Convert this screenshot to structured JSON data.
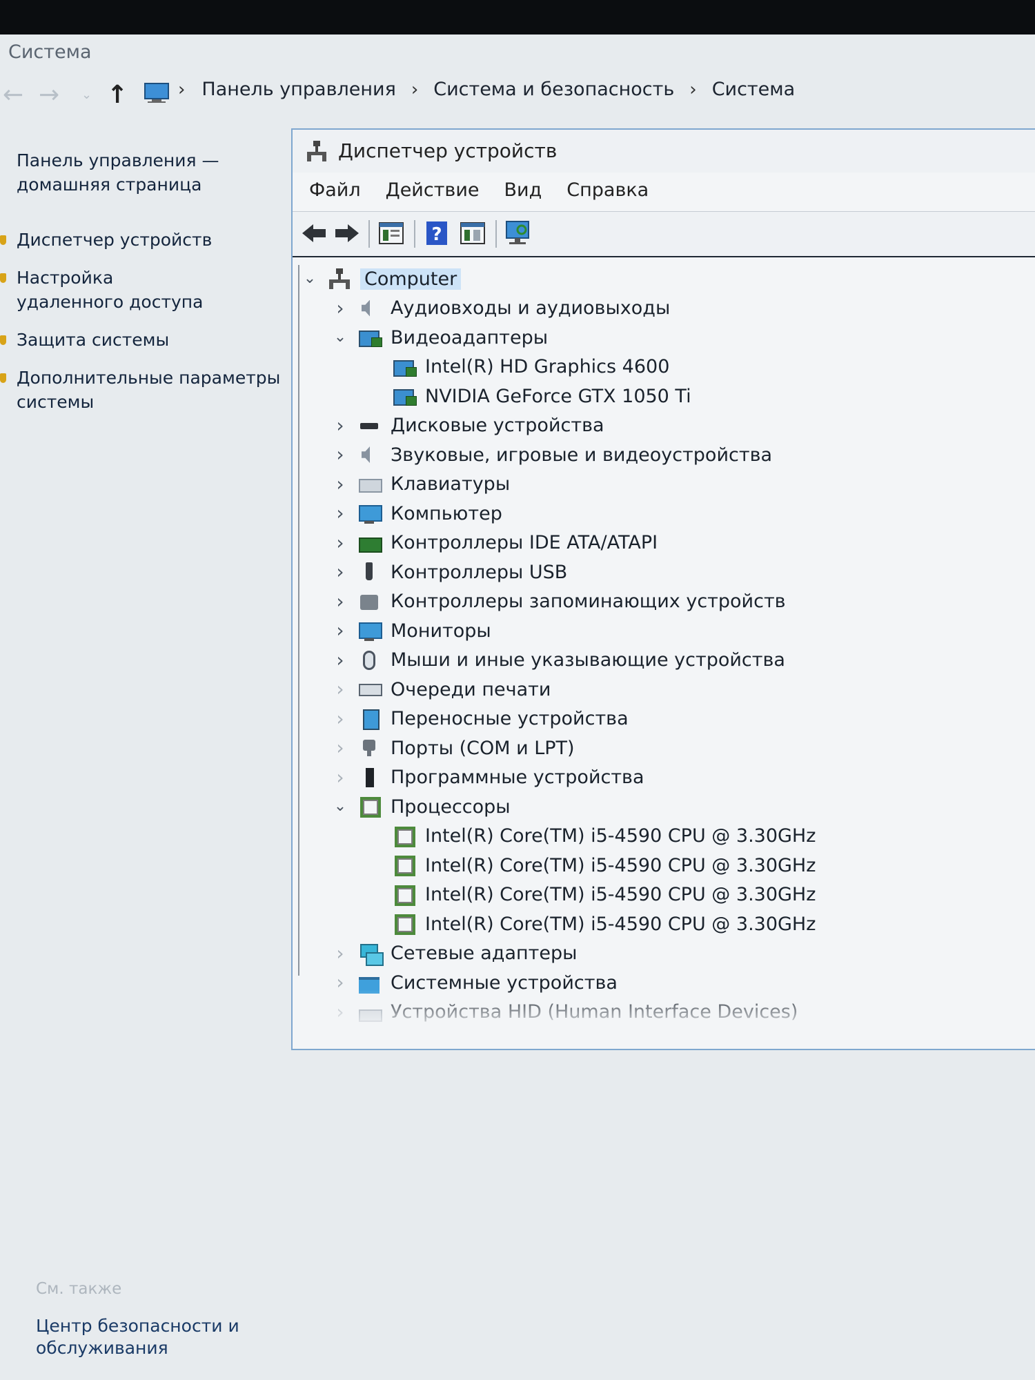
{
  "window": {
    "title": "Система"
  },
  "address": {
    "back_icon": "arrow-left-icon",
    "forward_icon": "arrow-right-icon",
    "up_icon": "arrow-up-icon",
    "crumbs": [
      "Панель управления",
      "Система и безопасность",
      "Система"
    ]
  },
  "sidebar": {
    "home_link": "Панель управления — домашняя страница",
    "links": [
      {
        "label": "Диспетчер устройств",
        "icon": "shield-icon"
      },
      {
        "label": "Настройка удаленного доступа",
        "icon": "shield-icon"
      },
      {
        "label": "Защита системы",
        "icon": "shield-icon"
      },
      {
        "label": "Дополнительные параметры системы",
        "icon": "shield-icon"
      }
    ],
    "see_also_title": "См. также",
    "see_also_link": "Центр безопасности и обслуживания"
  },
  "device_manager": {
    "title": "Диспетчер устройств",
    "menu": [
      "Файл",
      "Действие",
      "Вид",
      "Справка"
    ],
    "toolbar": [
      "back-icon",
      "forward-icon",
      "properties-icon",
      "help-icon",
      "view-icon",
      "monitor-scan-icon"
    ],
    "root": "Computer",
    "categories": [
      {
        "label": "Аудиовходы и аудиовыходы",
        "expanded": false,
        "icon": "speaker-icon"
      },
      {
        "label": "Видеоадаптеры",
        "expanded": true,
        "icon": "display-adapter-icon",
        "children": [
          "Intel(R) HD Graphics 4600",
          "NVIDIA GeForce GTX 1050 Ti"
        ]
      },
      {
        "label": "Дисковые устройства",
        "expanded": false,
        "icon": "disk-icon"
      },
      {
        "label": "Звуковые, игровые и видеоустройства",
        "expanded": false,
        "icon": "speaker-icon"
      },
      {
        "label": "Клавиатуры",
        "expanded": false,
        "icon": "keyboard-icon"
      },
      {
        "label": "Компьютер",
        "expanded": false,
        "icon": "monitor-icon"
      },
      {
        "label": "Контроллеры IDE ATA/ATAPI",
        "expanded": false,
        "icon": "ide-controller-icon"
      },
      {
        "label": "Контроллеры USB",
        "expanded": false,
        "icon": "usb-icon"
      },
      {
        "label": "Контроллеры запоминающих устройств",
        "expanded": false,
        "icon": "storage-controller-icon"
      },
      {
        "label": "Мониторы",
        "expanded": false,
        "icon": "monitor-icon"
      },
      {
        "label": "Мыши и иные указывающие устройства",
        "expanded": false,
        "icon": "mouse-icon"
      },
      {
        "label": "Очереди печати",
        "expanded": false,
        "icon": "printer-icon"
      },
      {
        "label": "Переносные устройства",
        "expanded": false,
        "icon": "portable-device-icon"
      },
      {
        "label": "Порты (COM и LPT)",
        "expanded": false,
        "icon": "port-icon"
      },
      {
        "label": "Программные устройства",
        "expanded": false,
        "icon": "software-device-icon"
      },
      {
        "label": "Процессоры",
        "expanded": true,
        "icon": "cpu-icon",
        "children": [
          "Intel(R) Core(TM) i5-4590 CPU @ 3.30GHz",
          "Intel(R) Core(TM) i5-4590 CPU @ 3.30GHz",
          "Intel(R) Core(TM) i5-4590 CPU @ 3.30GHz",
          "Intel(R) Core(TM) i5-4590 CPU @ 3.30GHz"
        ]
      },
      {
        "label": "Сетевые адаптеры",
        "expanded": false,
        "icon": "network-icon"
      },
      {
        "label": "Системные устройства",
        "expanded": false,
        "icon": "system-folder-icon"
      },
      {
        "label": "Устройства HID (Human Interface Devices)",
        "expanded": false,
        "icon": "hid-icon"
      }
    ]
  }
}
